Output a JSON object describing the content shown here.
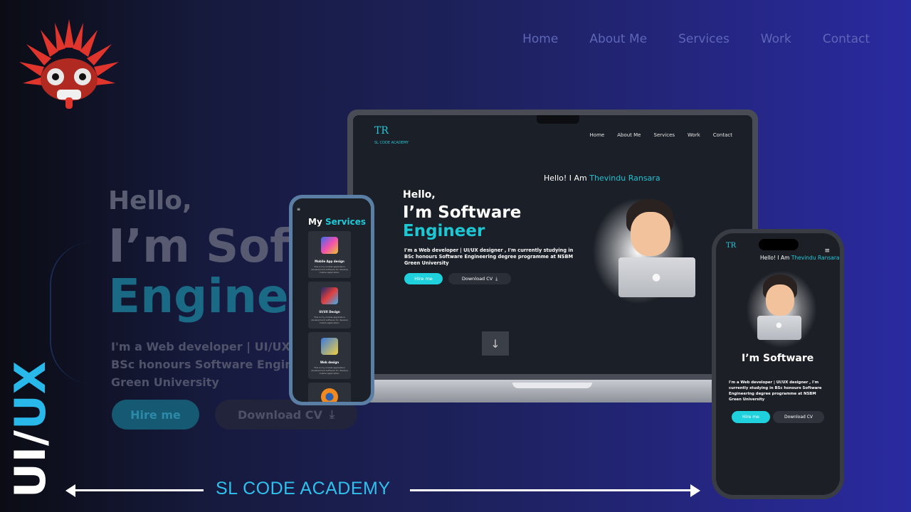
{
  "nav": {
    "items": [
      "Home",
      "About Me",
      "Services",
      "Work",
      "Contact"
    ]
  },
  "background_hero": {
    "hello": "Hello,",
    "soft": "I’m Soft",
    "eng": "Enginee",
    "desc_lines": [
      "I'm a Web developer | UI/UX de",
      "BSc honours Software Enginee",
      "Green University"
    ],
    "hire": "Hire me",
    "download": "Download CV"
  },
  "side_label": {
    "ui": "UI/",
    "ux": "UX"
  },
  "brand": "SL CODE ACADEMY",
  "laptop": {
    "logo": "TR",
    "logo_sub": "SL CODE ACADEMY",
    "nav": [
      "Home",
      "About Me",
      "Services",
      "Work",
      "Contact"
    ],
    "greeting": "Hello! I Am ",
    "name": "Thevindu Ransara",
    "hello": "Hello,",
    "title1": "I’m Software",
    "title2": "Engineer",
    "desc": "I'm a Web developer | UI/UX designer , I'm currently studying in BSc honours Software Engineering degree programme at NSBM Green University",
    "hire": "Hire me",
    "download": "Download CV"
  },
  "phone_left": {
    "title_a": "My ",
    "title_b": "Services",
    "cards": [
      {
        "title": "Mobile App design",
        "desc": "This is my mobile application development software for develop mobile application."
      },
      {
        "title": "UI/UX Design",
        "desc": "This is my mobile application development software for develop mobile application."
      },
      {
        "title": "Web design",
        "desc": "This is my mobile application development software for develop mobile application."
      }
    ]
  },
  "phone_right": {
    "logo": "TR",
    "greeting": "Hello! I Am ",
    "name": "Thevindu Ransara",
    "title": "I’m Software",
    "desc": "I'm a Web developer | UI/UX designer , I'm currently studying in BSc honours Software Engineering degree programme at NSBM Green University",
    "hire": "Hire me",
    "download": "Download CV"
  },
  "colors": {
    "accent": "#1fc9d8",
    "nav": "#5f66b8"
  }
}
